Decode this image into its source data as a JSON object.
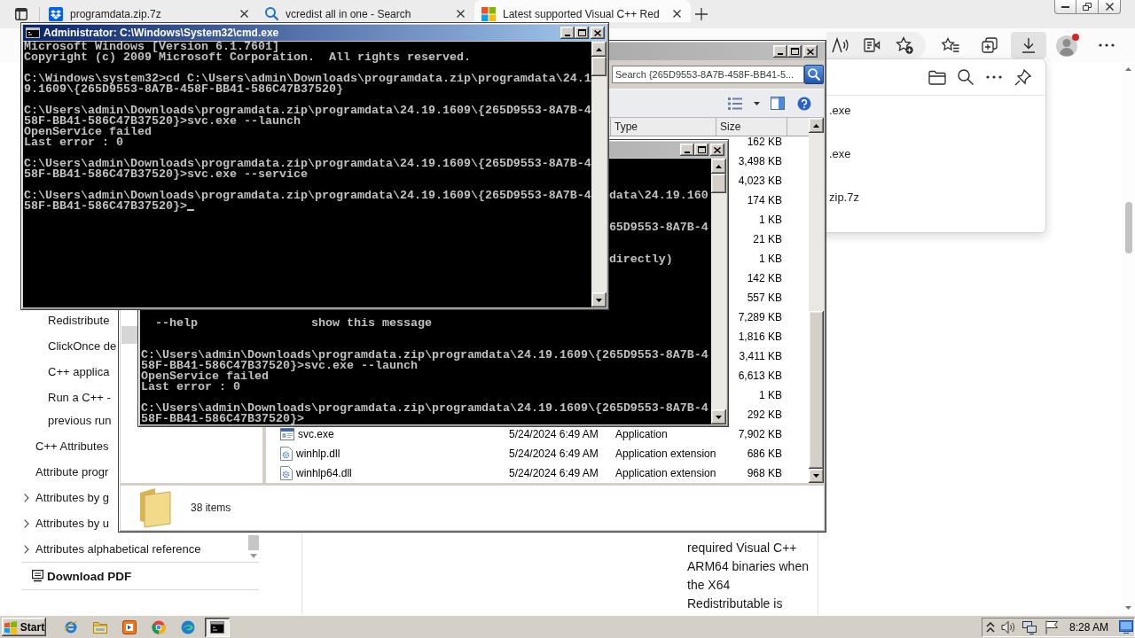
{
  "browser": {
    "tabs": [
      {
        "title": "programdata.zip.7z",
        "kind": "file",
        "selected": false
      },
      {
        "title": "vcredist all in one - Search",
        "kind": "search",
        "selected": false
      },
      {
        "title": "Latest supported Visual C++ Red",
        "kind": "docs",
        "selected": true
      }
    ],
    "toolbar_buttons": [
      {
        "kind": "favorites",
        "selected": false
      },
      {
        "kind": "collections",
        "selected": false
      },
      {
        "kind": "downloads",
        "selected": true
      },
      {
        "kind": "profile",
        "selected": false
      },
      {
        "kind": "more",
        "selected": false
      }
    ],
    "downloads_panel": {
      "items": [
        {
          "file": ".exe"
        },
        {
          "file": ".exe"
        },
        {
          "file": "zip.7z"
        }
      ]
    },
    "toc": [
      {
        "children": [
          {
            "lines": [
              "Redistribute"
            ]
          },
          {
            "lines": [
              "ClickOnce de"
            ]
          },
          {
            "lines": [
              "C++ applica"
            ]
          },
          {
            "lines": [
              "Run a C++ -",
              "previous run"
            ]
          }
        ]
      },
      {
        "lines": [
          "C++ Attributes"
        ]
      },
      {
        "lines": [
          "Attribute progr"
        ]
      },
      {
        "lines": [
          "Attributes by g"
        ],
        "expanded": false
      },
      {
        "lines": [
          "Attributes by u"
        ],
        "expanded": false
      },
      {
        "lines": [
          "Attributes alphabetical reference"
        ],
        "expanded": false
      }
    ],
    "download_pdf": "Download PDF",
    "article_text": "required Visual C++ ARM64 binaries when the X64 Redistributable is"
  },
  "explorer": {
    "active": false,
    "search": {
      "placeholder": "Search {265D9553-8A7B-458F-BB41-5..."
    },
    "nav_highlight": true,
    "columns": [
      "Type",
      "Size"
    ],
    "rows": [
      {
        "size": "162 KB"
      },
      {
        "size": "3,498 KB"
      },
      {
        "size": "4,023 KB"
      },
      {
        "size": "174 KB"
      },
      {
        "size": "1 KB"
      },
      {
        "size": "21 KB"
      },
      {
        "size": "1 KB"
      },
      {
        "size": "142 KB"
      },
      {
        "size": "557 KB"
      },
      {
        "size": "7,289 KB"
      },
      {
        "size": "1,816 KB"
      },
      {
        "size": "3,411 KB"
      },
      {
        "size": "6,613 KB"
      },
      {
        "size": "1 KB"
      },
      {
        "size": "292 KB"
      },
      {
        "kind": "exe",
        "name": "svc.exe",
        "date": "5/24/2024 6:49 AM",
        "type": "Application",
        "size": "7,902 KB"
      },
      {
        "kind": "dll",
        "name": "winhlp.dll",
        "date": "5/24/2024 6:49 AM",
        "type": "Application extension",
        "size": "686 KB"
      },
      {
        "kind": "dll",
        "name": "winhlp64.dll",
        "date": "5/24/2024 6:49 AM",
        "type": "Application extension",
        "size": "968 KB"
      }
    ],
    "status": "38 items"
  },
  "consoles": [
    {
      "title": "Administrator: C:\\Windows\\System32\\cmd.exe",
      "active": true,
      "blocks": [
        [
          "Microsoft Windows [Version 6.1.7601]",
          "Copyright (c) 2009 Microsoft Corporation.  All rights reserved."
        ],
        [
          "C:\\Windows\\system32>cd C:\\Users\\admin\\Downloads\\programdata.zip\\programdata\\24.1",
          "9.1609\\{265D9553-8A7B-458F-BB41-586C47B37520}"
        ],
        [
          "C:\\Users\\admin\\Downloads\\programdata.zip\\programdata\\24.19.1609\\{265D9553-8A7B-4",
          "58F-BB41-586C47B37520}>svc.exe --launch",
          "OpenService failed",
          "Last error : 0"
        ],
        [
          "C:\\Users\\admin\\Downloads\\programdata.zip\\programdata\\24.19.1609\\{265D9553-8A7B-4",
          "58F-BB41-586C47B37520}>svc.exe --service"
        ],
        [
          "C:\\Users\\admin\\Downloads\\programdata.zip\\programdata\\24.19.1609\\{265D9553-8A7B-4",
          "58F-BB41-586C47B37520}>"
        ]
      ]
    },
    {
      "active": false,
      "fragments": [
        "data\\24.19.160",
        "65D9553-8A7B-4",
        "directly)"
      ],
      "help_rows": [
        {
          "option": "--help",
          "description": "show this message"
        }
      ],
      "blocks": [
        [
          "C:\\Users\\admin\\Downloads\\programdata.zip\\programdata\\24.19.1609\\{265D9553-8A7B-4",
          "58F-BB41-586C47B37520}>svc.exe --launch",
          "OpenService failed",
          "Last error : 0"
        ],
        [
          "C:\\Users\\admin\\Downloads\\programdata.zip\\programdata\\24.19.1609\\{265D9553-8A7B-4",
          "58F-BB41-586C47B37520}>"
        ]
      ]
    }
  ],
  "taskbar": {
    "start": "Start",
    "buttons": [
      {
        "kind": "ie",
        "selected": false
      },
      {
        "kind": "folder",
        "selected": false
      },
      {
        "kind": "media",
        "selected": false
      },
      {
        "kind": "chrome",
        "selected": false
      },
      {
        "kind": "edge",
        "selected": false
      },
      {
        "kind": "console",
        "selected": true
      }
    ],
    "clock": "8:28 AM"
  }
}
